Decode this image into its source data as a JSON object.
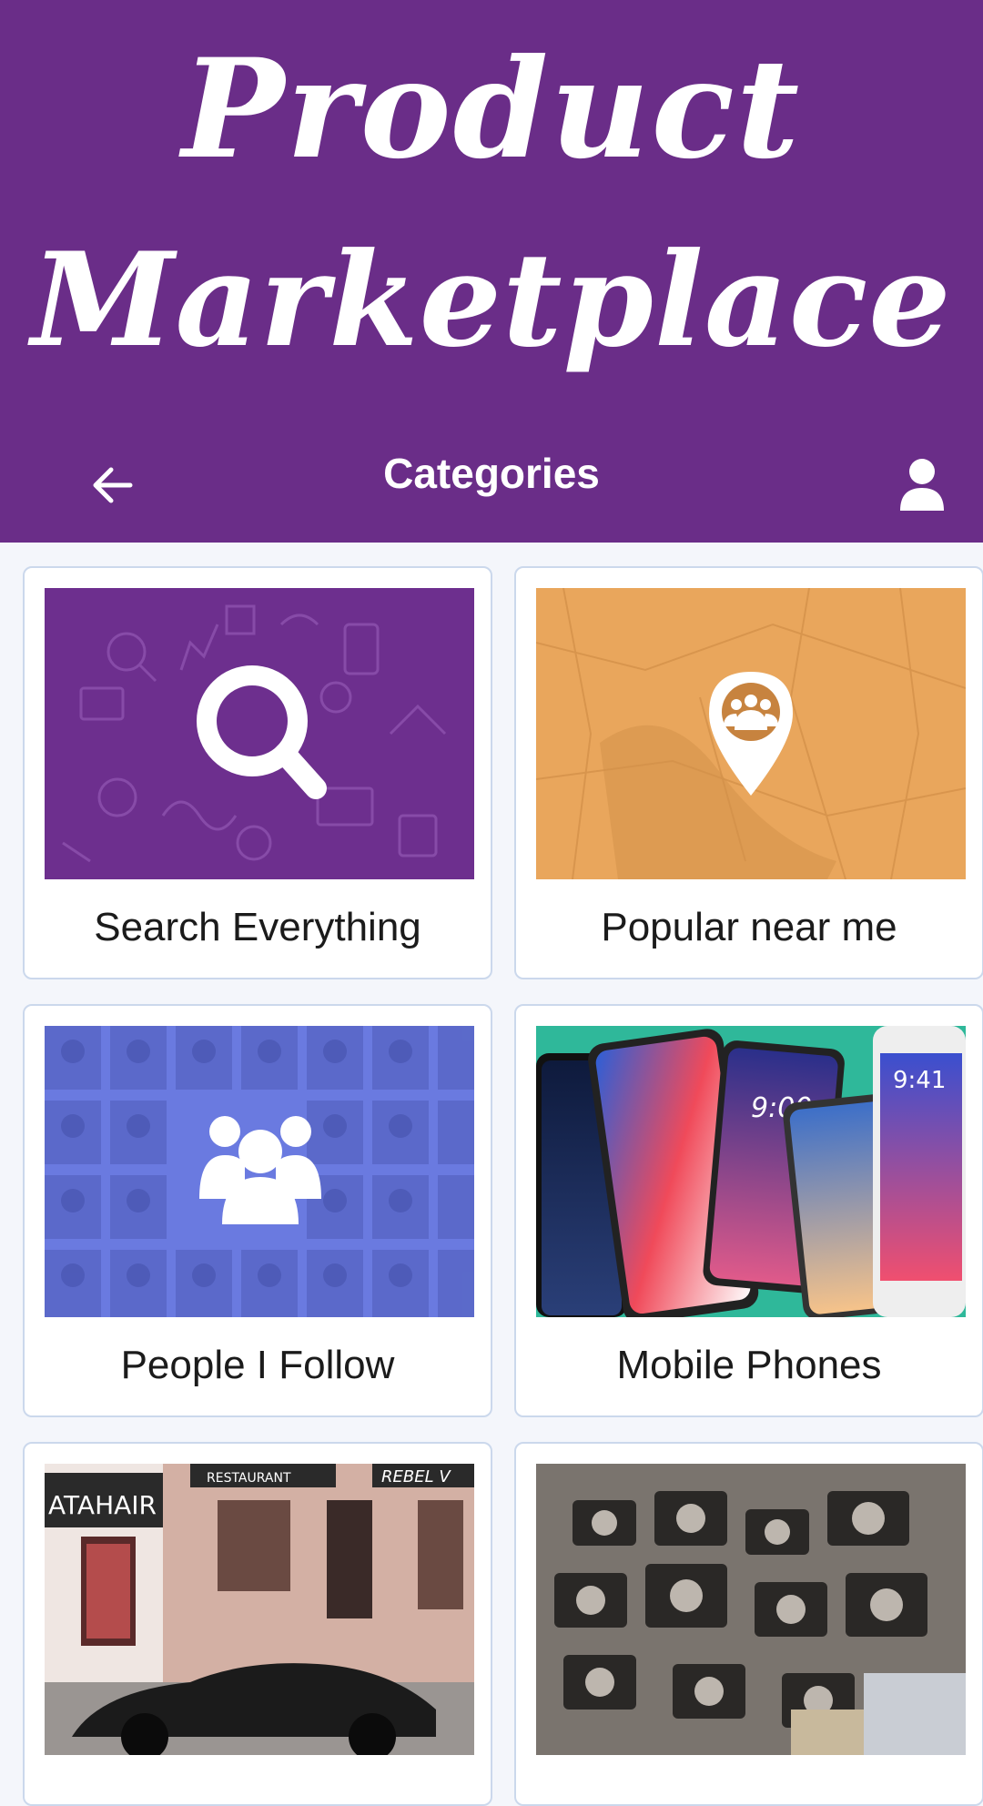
{
  "promo": {
    "line1": "Product",
    "line2": "Marketplace"
  },
  "appbar": {
    "title": "Categories",
    "back_icon": "arrow-left-icon",
    "profile_icon": "person-icon"
  },
  "categories": [
    {
      "label": "Search Everything",
      "icon": "magnifier-icon"
    },
    {
      "label": "Popular near me",
      "icon": "map-pin-group-icon"
    },
    {
      "label": "People I Follow",
      "icon": "people-group-icon"
    },
    {
      "label": "Mobile Phones",
      "icon": "phones-photo"
    },
    {
      "label": "",
      "icon": "street-car-photo"
    },
    {
      "label": "",
      "icon": "vintage-cameras-photo"
    }
  ],
  "image_text": {
    "store_sign": "ATAHAIR",
    "restaurant_sign": "RESTAURANT",
    "rebel_sign": "REBEL V",
    "phone_clock_1": "9:00",
    "phone_clock_2": "9:41"
  },
  "colors": {
    "brand_purple": "#6a2d88",
    "background": "#f4f6fb",
    "card_border": "#cbd8ec",
    "search_tile": "#6d2f8e",
    "popular_tile": "#e9a65c",
    "people_tile": "#6a7ae0"
  }
}
